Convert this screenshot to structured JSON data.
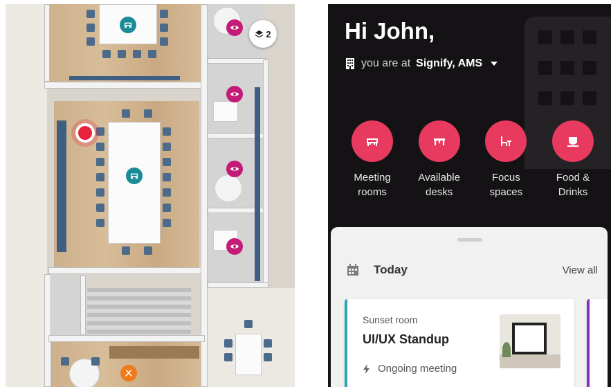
{
  "map": {
    "layers_count": "2",
    "pins": {
      "meeting_top": "chair-icon",
      "meeting_main": "chair-icon",
      "view_1": "eye-icon",
      "view_2": "eye-icon",
      "view_3": "eye-icon",
      "view_4": "eye-icon",
      "food": "cutlery-icon"
    },
    "colors": {
      "teal": "#1a8a97",
      "magenta": "#c41a78",
      "orange": "#f07a1a",
      "location": "#e8213d"
    }
  },
  "app": {
    "greeting": "Hi John,",
    "location_prefix": "you are at",
    "location_name": "Signify, AMS",
    "accent": "#e83a5e",
    "categories": [
      {
        "label": "Meeting\nrooms",
        "icon": "meeting-chair-icon"
      },
      {
        "label": "Available\ndesks",
        "icon": "desk-icon"
      },
      {
        "label": "Focus\nspaces",
        "icon": "focus-chair-icon"
      },
      {
        "label": "Food &\nDrinks",
        "icon": "cup-icon"
      }
    ],
    "today": {
      "title": "Today",
      "view_all": "View all",
      "card": {
        "room": "Sunset room",
        "title": "UI/UX Standup",
        "status": "Ongoing meeting",
        "accent": "#2aa6b3"
      }
    }
  }
}
